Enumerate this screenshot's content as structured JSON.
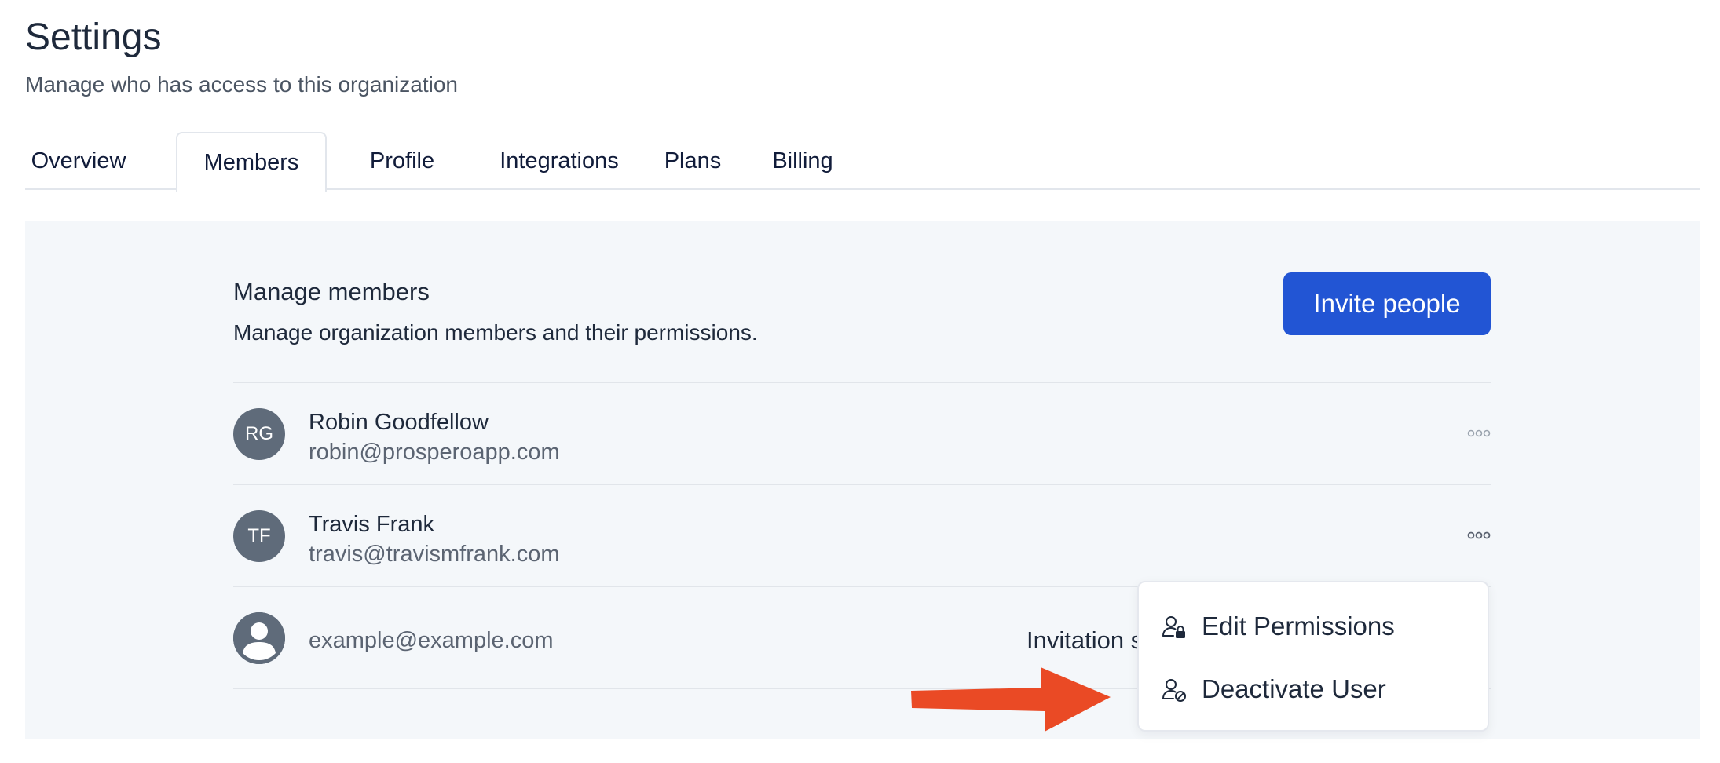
{
  "header": {
    "title": "Settings",
    "subtitle": "Manage who has access to this organization"
  },
  "tabs": [
    {
      "label": "Overview",
      "active": false
    },
    {
      "label": "Members",
      "active": true
    },
    {
      "label": "Profile",
      "active": false
    },
    {
      "label": "Integrations",
      "active": false
    },
    {
      "label": "Plans",
      "active": false
    },
    {
      "label": "Billing",
      "active": false
    }
  ],
  "members_section": {
    "title": "Manage members",
    "description": "Manage organization members and their permissions.",
    "invite_label": "Invite people"
  },
  "members": [
    {
      "initials": "RG",
      "name": "Robin Goodfellow",
      "email": "robin@prosperoapp.com",
      "more_icon": "more-horizontal-icon"
    },
    {
      "initials": "TF",
      "name": "Travis Frank",
      "email": "travis@travismfrank.com",
      "more_icon": "more-horizontal-icon"
    },
    {
      "avatar_icon": "user-placeholder-icon",
      "email": "example@example.com",
      "status": "Invitation se"
    }
  ],
  "menu": {
    "items": [
      {
        "label": "Edit Permissions",
        "icon": "user-lock-icon"
      },
      {
        "label": "Deactivate User",
        "icon": "user-block-icon"
      }
    ]
  },
  "colors": {
    "accent": "#2255d4",
    "panel_bg": "#f4f7fa",
    "avatar": "#5f6b7a",
    "annotation_arrow": "#ea4a25"
  }
}
